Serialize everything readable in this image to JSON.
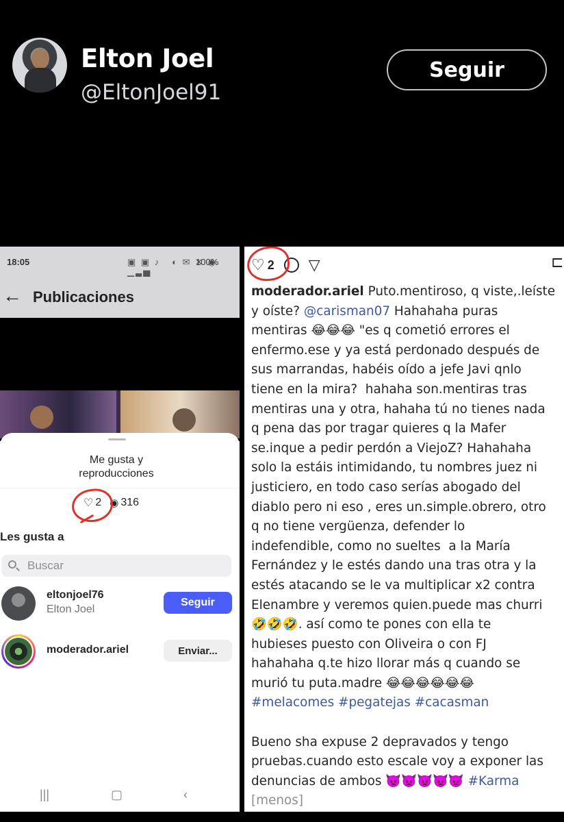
{
  "tweet": {
    "display_name": "Elton Joel",
    "handle": "@EltonJoel91",
    "follow_label": "Seguir"
  },
  "left_screenshot": {
    "status_time": "18:05",
    "status_battery": "100%",
    "header_title": "Publicaciones",
    "sheet_title_line1": "Me gusta y",
    "sheet_title_line2": "reproducciones",
    "likes_count": "2",
    "views_count": "316",
    "likes_section_title": "Les gusta a",
    "search_placeholder": "Buscar",
    "users": [
      {
        "username": "eltonjoel76",
        "full_name": "Elton Joel",
        "action": "Seguir"
      },
      {
        "username": "moderador.ariel",
        "full_name": "",
        "action": "Enviar..."
      }
    ]
  },
  "right_screenshot": {
    "likes_count": "2",
    "caption_user": "moderador.ariel",
    "caption_line1": " Puto.mentiroso, q viste,.leíste",
    "caption_line2_pre": "y oíste? ",
    "caption_mention": "@carisman07",
    "caption_line2_post": " Hahahaha puras",
    "caption_body": "mentiras 😂😂😂 \"es q cometió errores el\nenfermo.ese y ya está perdonado después de\nsus marrandas, habéis oído a jefe Javi qnlo\ntiene en la mira?  hahaha son.mentiras tras\nmentiras una y otra, hahaha tú no tienes nada\nq pena das por tragar quieres q la Mafer\nse.inque a pedir perdón a ViejoZ? Hahahaha\nsolo la estáis intimidando, tu nombres juez ni\njusticiero, en todo caso serías abogado del\ndiablo pero ni eso , eres un.simple.obrero, otro\nq no tiene vergüenza, defender lo\nindefendible, como no sueltes  a la María\nFernández y le estés dando una tras otra y la\nestés atacando se le va multiplicar x2 contra\nElenambre y veremos quien.puede mas churri\n🤣🤣🤣. así como te pones con ella te\nhubieses puesto con Oliveira o con FJ\nhahahaha q.te hizo llorar más q cuando se\nmurió tu puta.madre 😂😂😂😂😂😂",
    "caption_tags": "#melacomes #pegatejas #cacasman",
    "caption_tail": "Bueno sha expuse 2 depravados y tengo\npruebas.cuando esto escale voy a exponer las\ndenuncias de ambos 👿👿👿👿👿 ",
    "caption_tail_tag": "#Karma",
    "more_label": "[menos]"
  }
}
